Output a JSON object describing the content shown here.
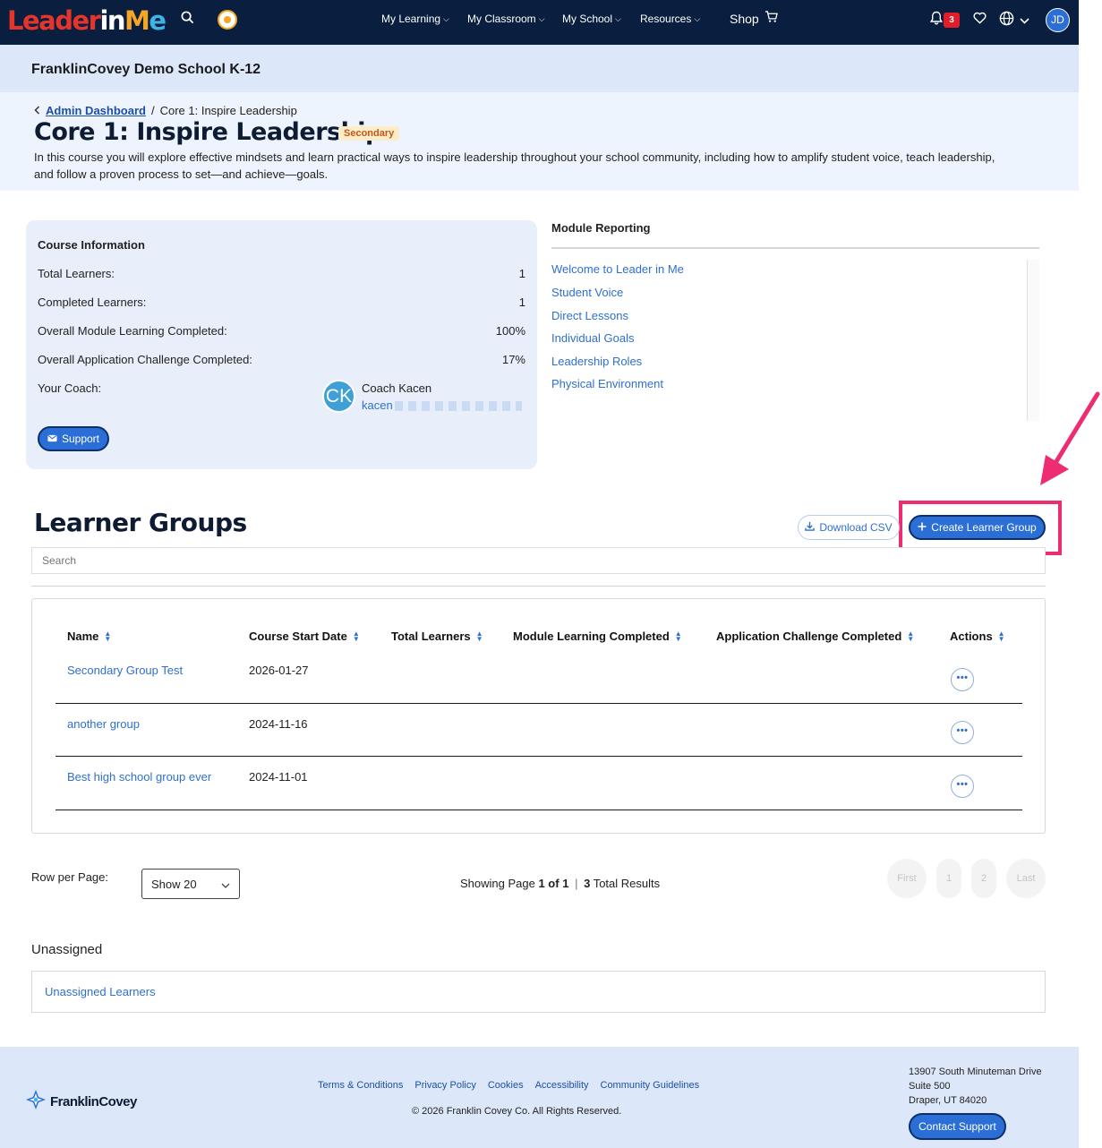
{
  "nav": {
    "logo": {
      "part1": "Leader",
      "part2": "in",
      "part3": "M",
      "part4": "e"
    },
    "menu": [
      {
        "label": "My Learning"
      },
      {
        "label": "My Classroom"
      },
      {
        "label": "My School"
      },
      {
        "label": "Resources"
      }
    ],
    "shop": "Shop",
    "notification_count": "3",
    "user_initials": "JD"
  },
  "school": {
    "name": "FranklinCovey Demo School K-12"
  },
  "breadcrumb": {
    "parent": "Admin Dashboard",
    "separator": "/",
    "current": "Core 1: Inspire Leadership"
  },
  "course": {
    "title": "Core 1: Inspire Leadership",
    "level": "Secondary",
    "description": "In this course you will explore effective mindsets and learn practical ways to inspire leadership throughout your school community, including how to amplify student voice, teach leadership, and follow a proven process to set—and achieve—goals."
  },
  "course_info": {
    "heading": "Course Information",
    "rows": [
      {
        "label": "Total Learners:",
        "value": "1"
      },
      {
        "label": "Completed Learners:",
        "value": "1"
      },
      {
        "label": "Overall Module Learning Completed:",
        "value": "100%"
      },
      {
        "label": "Overall Application Challenge Completed:",
        "value": "17%"
      }
    ],
    "coach_label": "Your Coach:",
    "coach_initials": "CK",
    "coach_name": "Coach Kacen",
    "coach_email_visible": "kacen",
    "support_label": "Support"
  },
  "module_reporting": {
    "heading": "Module Reporting",
    "items": [
      "Welcome to Leader in Me",
      "Student Voice",
      "Direct Lessons",
      "Individual Goals",
      "Leadership Roles",
      "Physical Environment"
    ]
  },
  "learner_groups": {
    "title": "Learner Groups",
    "download_label": "Download CSV",
    "create_label": "Create Learner Group",
    "search_placeholder": "Search",
    "columns": [
      "Name",
      "Course Start Date",
      "Total Learners",
      "Module Learning Completed",
      "Application Challenge Completed",
      "Actions"
    ],
    "rows": [
      {
        "name": "Secondary Group Test",
        "start_date": "2026-01-27"
      },
      {
        "name": "another group",
        "start_date": "2024-11-16"
      },
      {
        "name": "Best high school group ever",
        "start_date": "2024-11-01"
      }
    ],
    "actions_glyph": "•••"
  },
  "pagination": {
    "rows_label": "Row per Page:",
    "rows_value": "Show 20",
    "showing_prefix": "Showing Page",
    "page_of": "1 of 1",
    "separator": "|",
    "total_count": "3",
    "total_suffix": "Total Results",
    "buttons": {
      "first": "First",
      "p1": "1",
      "p2": "2",
      "last": "Last"
    }
  },
  "unassigned": {
    "title": "Unassigned",
    "link": "Unassigned Learners"
  },
  "footer": {
    "brand": "FranklinCovey",
    "links": [
      "Terms & Conditions",
      "Privacy Policy",
      "Cookies",
      "Accessibility",
      "Community Guidelines"
    ],
    "copyright": "© 2026 Franklin Covey Co. All Rights Reserved.",
    "address": {
      "line1": "13907 South Minuteman Drive",
      "line2": "Suite 500",
      "line3": "Draper, UT 84020"
    },
    "contact_label": "Contact Support"
  },
  "colors": {
    "nav_bg": "#0a1f3f",
    "primary": "#2b6fd6",
    "link": "#2f6fcf",
    "highlight": "#ee2c72",
    "light_panel": "#dce8fa"
  }
}
